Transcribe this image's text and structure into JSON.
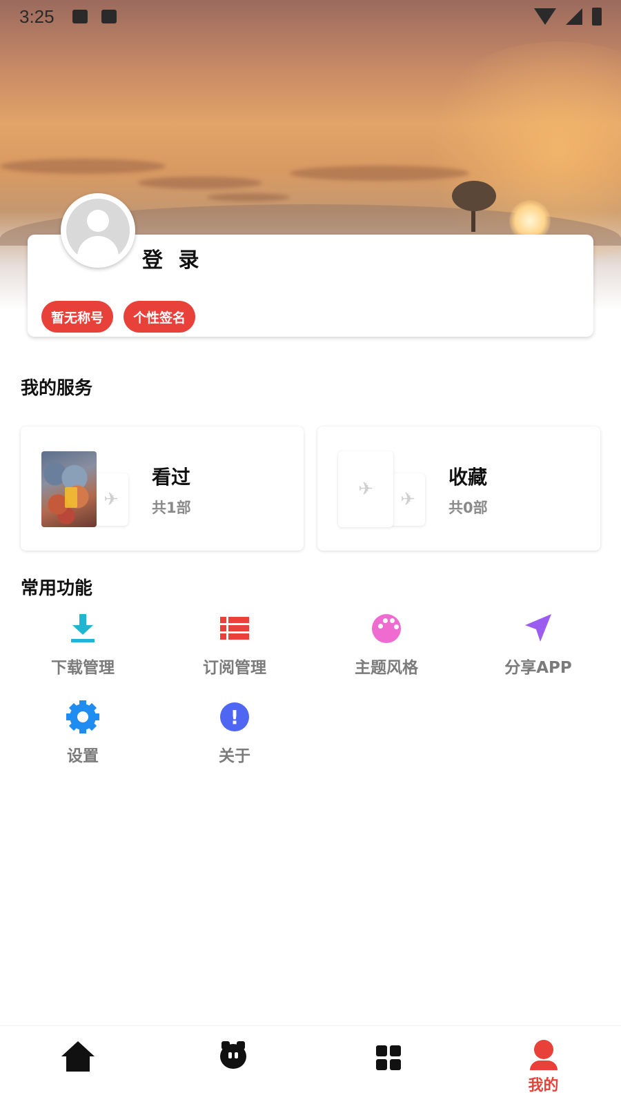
{
  "status_bar": {
    "time": "3:25"
  },
  "profile": {
    "login_label": "登 录",
    "chips": [
      "暂无称号",
      "个性签名"
    ]
  },
  "services": {
    "title": "我的服务",
    "items": [
      {
        "title": "看过",
        "count": "共1部"
      },
      {
        "title": "收藏",
        "count": "共0部"
      }
    ]
  },
  "functions": {
    "title": "常用功能",
    "items": [
      {
        "label": "下载管理",
        "icon": "download-icon",
        "color": "#1fb6d2"
      },
      {
        "label": "订阅管理",
        "icon": "list-icon",
        "color": "#e8413a"
      },
      {
        "label": "主题风格",
        "icon": "palette-icon",
        "color": "#f06bd0"
      },
      {
        "label": "分享APP",
        "icon": "send-icon",
        "color": "#9b5cf0"
      },
      {
        "label": "设置",
        "icon": "gear-icon",
        "color": "#1e8cf0"
      },
      {
        "label": "关于",
        "icon": "info-icon",
        "color": "#4f66f2"
      }
    ]
  },
  "bottom_nav": {
    "items": [
      {
        "icon": "home-icon",
        "label": ""
      },
      {
        "icon": "face-icon",
        "label": ""
      },
      {
        "icon": "grid-icon",
        "label": ""
      },
      {
        "icon": "person-icon",
        "label": "我的",
        "active": true
      }
    ],
    "active_color": "#e8413a"
  },
  "colors": {
    "accent": "#e8413a"
  }
}
